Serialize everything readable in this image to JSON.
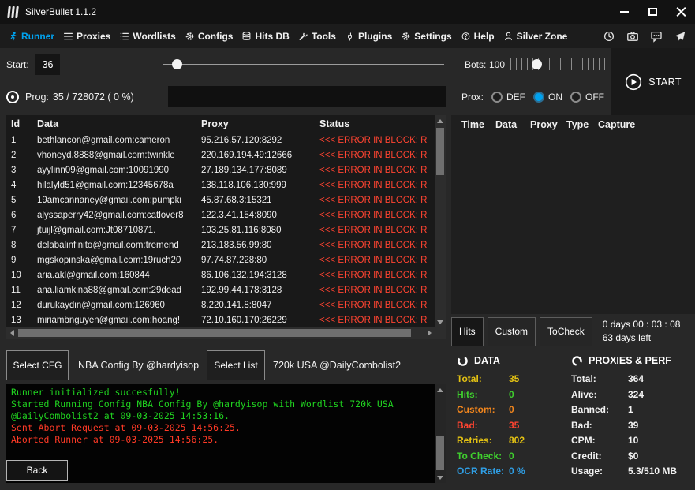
{
  "theme": {
    "accent_blue": "#00a3f0",
    "error_red": "#ff4431",
    "log_green": "#20d320",
    "log_red": "#ff3a26",
    "stat_yellow": "#e5c313",
    "stat_green": "#3fcf2e",
    "stat_orange": "#f2861d",
    "stat_blue": "#2f9fe6"
  },
  "window": {
    "title": "SilverBullet 1.1.2"
  },
  "nav": {
    "items": [
      {
        "label": "Runner",
        "icon": "runner-icon",
        "active": true
      },
      {
        "label": "Proxies",
        "icon": "list-icon",
        "active": false
      },
      {
        "label": "Wordlists",
        "icon": "wordlist-icon",
        "active": false
      },
      {
        "label": "Configs",
        "icon": "gear-icon",
        "active": false
      },
      {
        "label": "Hits DB",
        "icon": "database-icon",
        "active": false
      },
      {
        "label": "Tools",
        "icon": "wrench-icon",
        "active": false
      },
      {
        "label": "Plugins",
        "icon": "plug-icon",
        "active": false
      },
      {
        "label": "Settings",
        "icon": "gear-icon",
        "active": false
      },
      {
        "label": "Help",
        "icon": "help-icon",
        "active": false
      },
      {
        "label": "Silver Zone",
        "icon": "person-icon",
        "active": false
      }
    ]
  },
  "runner": {
    "start_label": "Start:",
    "start_value": "36",
    "bots_label": "Bots:",
    "bots_value": "100",
    "start_button_label": "START",
    "prog_label": "Prog:",
    "prog_value": "35 / 728072 ( 0 %)",
    "prox_label": "Prox:",
    "prox_options": [
      {
        "label": "DEF",
        "selected": false
      },
      {
        "label": "ON",
        "selected": true
      },
      {
        "label": "OFF",
        "selected": false
      }
    ]
  },
  "results_table": {
    "headers": [
      "Id",
      "Data",
      "Proxy",
      "Status"
    ],
    "rows": [
      {
        "id": "1",
        "data": "bethlancon@gmail.com:cameron",
        "proxy": "95.216.57.120:8292",
        "status": "<<< ERROR IN BLOCK: R"
      },
      {
        "id": "2",
        "data": "vhoneyd.8888@gmail.com:twinkle",
        "proxy": "220.169.194.49:12666",
        "status": "<<< ERROR IN BLOCK: R"
      },
      {
        "id": "3",
        "data": "ayylinn09@gmail.com:10091990",
        "proxy": "27.189.134.177:8089",
        "status": "<<< ERROR IN BLOCK: R"
      },
      {
        "id": "4",
        "data": "hilalyld51@gmail.com:12345678a",
        "proxy": "138.118.106.130:999",
        "status": "<<< ERROR IN BLOCK: R"
      },
      {
        "id": "5",
        "data": "19amcannaney@gmail.com:pumpki",
        "proxy": "45.87.68.3:15321",
        "status": "<<< ERROR IN BLOCK: R"
      },
      {
        "id": "6",
        "data": "alyssaperry42@gmail.com:catlover8",
        "proxy": "122.3.41.154:8090",
        "status": "<<< ERROR IN BLOCK: R"
      },
      {
        "id": "7",
        "data": "jtuijl@gmail.com:Jt08710871.",
        "proxy": "103.25.81.116:8080",
        "status": "<<< ERROR IN BLOCK: R"
      },
      {
        "id": "8",
        "data": "delabalinfinito@gmail.com:tremend",
        "proxy": "213.183.56.99:80",
        "status": "<<< ERROR IN BLOCK: R"
      },
      {
        "id": "9",
        "data": "mgskopinska@gmail.com:19ruch20",
        "proxy": "97.74.87.228:80",
        "status": "<<< ERROR IN BLOCK: R"
      },
      {
        "id": "10",
        "data": "aria.akl@gmail.com:160844",
        "proxy": "86.106.132.194:3128",
        "status": "<<< ERROR IN BLOCK: R"
      },
      {
        "id": "11",
        "data": "ana.liamkina88@gmail.com:29dead",
        "proxy": "192.99.44.178:3128",
        "status": "<<< ERROR IN BLOCK: R"
      },
      {
        "id": "12",
        "data": "durukaydin@gmail.com:126960",
        "proxy": "8.220.141.8:8047",
        "status": "<<< ERROR IN BLOCK: R"
      },
      {
        "id": "13",
        "data": "miriambnguyen@gmail.com:hoang!",
        "proxy": "72.10.160.170:26229",
        "status": "<<< ERROR IN BLOCK: R"
      }
    ]
  },
  "hits_panel": {
    "headers": [
      "Time",
      "Data",
      "Proxy",
      "Type",
      "Capture"
    ]
  },
  "tabs": {
    "items": [
      "Hits",
      "Custom",
      "ToCheck"
    ],
    "active": "Hits",
    "timer": "0 days 00 : 03 : 08",
    "remaining": "63 days left"
  },
  "config_bar": {
    "select_cfg_label": "Select CFG",
    "config_name": "NBA Config By @hardyisop",
    "select_list_label": "Select List",
    "wordlist_name": "720k USA @DailyCombolist2"
  },
  "log": {
    "lines": [
      {
        "text": "Runner initialized succesfully!",
        "color": "green"
      },
      {
        "text": "Started Running Config NBA Config By @hardyisop with Wordlist 720k USA @DailyCombolist2 at 09-03-2025 14:53:16.",
        "color": "green"
      },
      {
        "text": "Sent Abort Request at 09-03-2025 14:56:25.",
        "color": "red"
      },
      {
        "text": "Aborted Runner at 09-03-2025 14:56:25.",
        "color": "red"
      }
    ]
  },
  "back_label": "Back",
  "stats": {
    "data": {
      "title": "DATA",
      "items": [
        {
          "label": "Total:",
          "value": "35",
          "color": "yellow"
        },
        {
          "label": "Hits:",
          "value": "0",
          "color": "green"
        },
        {
          "label": "Custom:",
          "value": "0",
          "color": "orange"
        },
        {
          "label": "Bad:",
          "value": "35",
          "color": "red"
        },
        {
          "label": "Retries:",
          "value": "802",
          "color": "yellow"
        },
        {
          "label": "To Check:",
          "value": "0",
          "color": "green"
        },
        {
          "label": "OCR Rate:",
          "value": "0 %",
          "color": "blue"
        }
      ]
    },
    "proxies": {
      "title": "PROXIES & PERF",
      "items": [
        {
          "label": "Total:",
          "value": "364",
          "color": "white"
        },
        {
          "label": "Alive:",
          "value": "324",
          "color": "white"
        },
        {
          "label": "Banned:",
          "value": "1",
          "color": "white"
        },
        {
          "label": "Bad:",
          "value": "39",
          "color": "white"
        },
        {
          "label": "CPM:",
          "value": "10",
          "color": "white"
        },
        {
          "label": "Credit:",
          "value": "$0",
          "color": "white"
        },
        {
          "label": "Usage:",
          "value": "5.3/510 MB",
          "color": "white"
        }
      ]
    }
  }
}
